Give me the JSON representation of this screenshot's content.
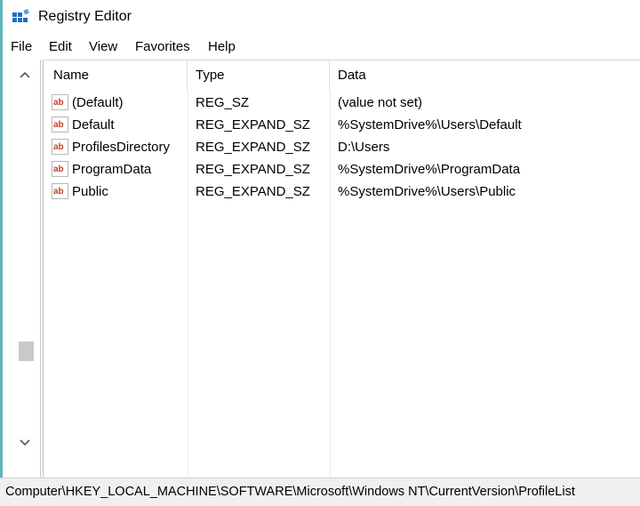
{
  "window": {
    "title": "Registry Editor"
  },
  "menu": [
    "File",
    "Edit",
    "View",
    "Favorites",
    "Help"
  ],
  "columns": {
    "name": "Name",
    "type": "Type",
    "data": "Data"
  },
  "values": [
    {
      "name": "(Default)",
      "type": "REG_SZ",
      "data": "(value not set)"
    },
    {
      "name": "Default",
      "type": "REG_EXPAND_SZ",
      "data": "%SystemDrive%\\Users\\Default"
    },
    {
      "name": "ProfilesDirectory",
      "type": "REG_EXPAND_SZ",
      "data": "D:\\Users"
    },
    {
      "name": "ProgramData",
      "type": "REG_EXPAND_SZ",
      "data": "%SystemDrive%\\ProgramData"
    },
    {
      "name": "Public",
      "type": "REG_EXPAND_SZ",
      "data": "%SystemDrive%\\Users\\Public"
    }
  ],
  "value_icon": {
    "name": "string-value-icon",
    "glyph": "ab",
    "color": "#c8402b"
  },
  "status": {
    "path": "Computer\\HKEY_LOCAL_MACHINE\\SOFTWARE\\Microsoft\\Windows NT\\CurrentVersion\\ProfileList"
  },
  "colors": {
    "accent": "#5fb3b8",
    "app_icon": "#1f6fc4"
  }
}
